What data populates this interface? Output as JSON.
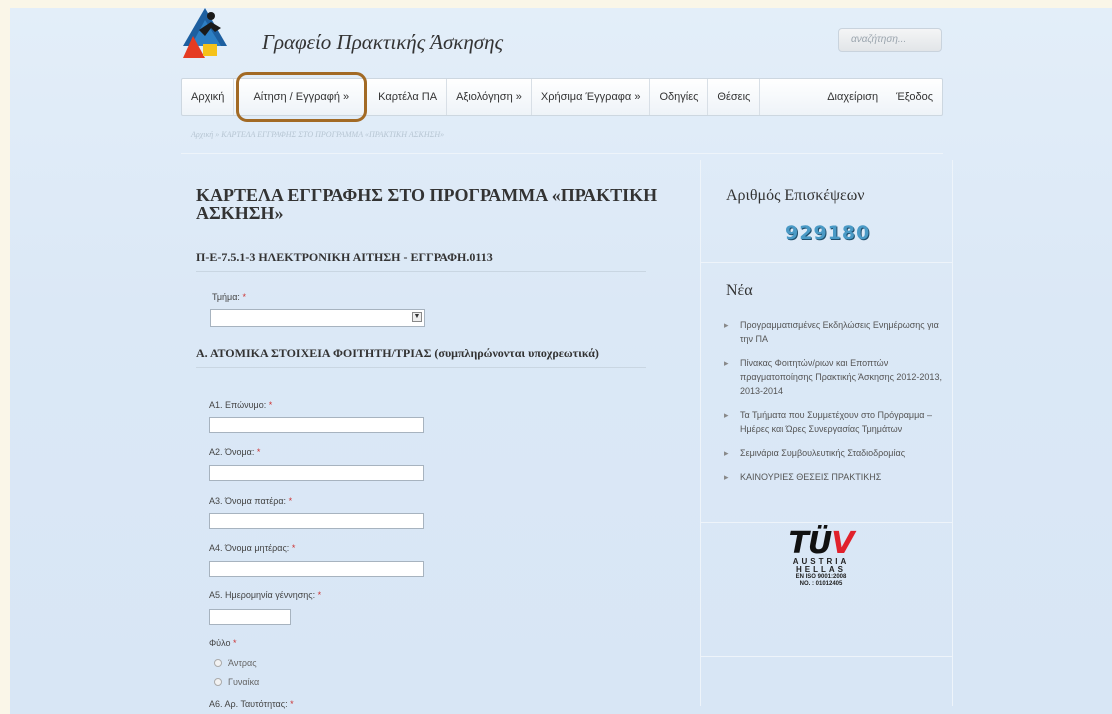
{
  "header": {
    "site_title": "Γραφείο Πρακτικής Άσκησης",
    "search_placeholder": "αναζήτηση..."
  },
  "nav": {
    "items": [
      "Αρχική",
      "Αίτηση / Εγγραφή »",
      "Καρτέλα ΠΑ",
      "Αξιολόγηση »",
      "Χρήσιμα Έγγραφα »",
      "Οδηγίες",
      "Θέσεις",
      "Διαχείριση",
      "Έξοδος"
    ]
  },
  "breadcrumb": "Αρχική » ΚΑΡΤΕΛΑ ΕΓΓΡΑΦΗΣ ΣΤΟ ΠΡΟΓΡΑΜΜΑ «ΠΡΑΚΤΙΚΗ ΑΣΚΗΣΗ»",
  "main": {
    "page_title": "ΚΑΡΤΕΛΑ ΕΓΓΡΑΦΗΣ ΣΤΟ ΠΡΟΓΡΑΜΜΑ «ΠΡΑΚΤΙΚΗ ΑΣΚΗΣΗ»",
    "form_code": "Π-Ε-7.5.1-3 ΗΛΕΚΤΡΟΝΙΚΗ ΑΙΤΗΣΗ - ΕΓΓΡΑΦΗ.0113",
    "department_label": "Τμήμα:",
    "section_a": "Α. ΑΤΟΜΙΚΑ ΣΤΟΙΧΕΙΑ ΦΟΙΤΗΤΗ/ΤΡΙΑΣ (συμπληρώνονται υποχρεωτικά)",
    "fields": {
      "surname": "Α1. Επώνυμο:",
      "name": "Α2. Όνομα:",
      "father": "Α3. Όνομα πατέρα:",
      "mother": "Α4. Όνομα μητέρας:",
      "birthdate": "Α5. Ημερομηνία γέννησης:",
      "gender": "Φύλο",
      "id_number": "Α6. Αρ. Ταυτότητας:"
    },
    "gender_options": [
      "Άντρας",
      "Γυναίκα"
    ],
    "required_mark": "*"
  },
  "sidebar": {
    "visits_title": "Αριθμός Επισκέψεων",
    "visits_count": "929180",
    "news_title": "Νέα",
    "news": [
      "Προγραμματισμένες Εκδηλώσεις Ενημέρωσης για την ΠΑ",
      "Πίνακας Φοιτητών/ριων και Εποπτών πραγματοποίησης Πρακτικής Άσκησης 2012-2013, 2013-2014",
      "Τα Τμήματα που Συμμετέχουν στο Πρόγραμμα – Ημέρες και Ώρες Συνεργασίας Τμημάτων",
      "Σεμινάρια Συμβουλευτικής Σταδιοδρομίας",
      "ΚΑΙΝΟΥΡΙΕΣ ΘΕΣΕΙΣ ΠΡΑΚΤΙΚΗΣ"
    ],
    "tuv": {
      "logo": "TÜV",
      "line1": "AUSTRIA",
      "line2": "HELLAS",
      "cert": "EN ISO 9001:2008",
      "no": "NO. : 01012405"
    }
  },
  "colors": {
    "accent_highlight": "#a26a25",
    "counter": "#4a9ac6",
    "tuv_red": "#e1212b"
  }
}
